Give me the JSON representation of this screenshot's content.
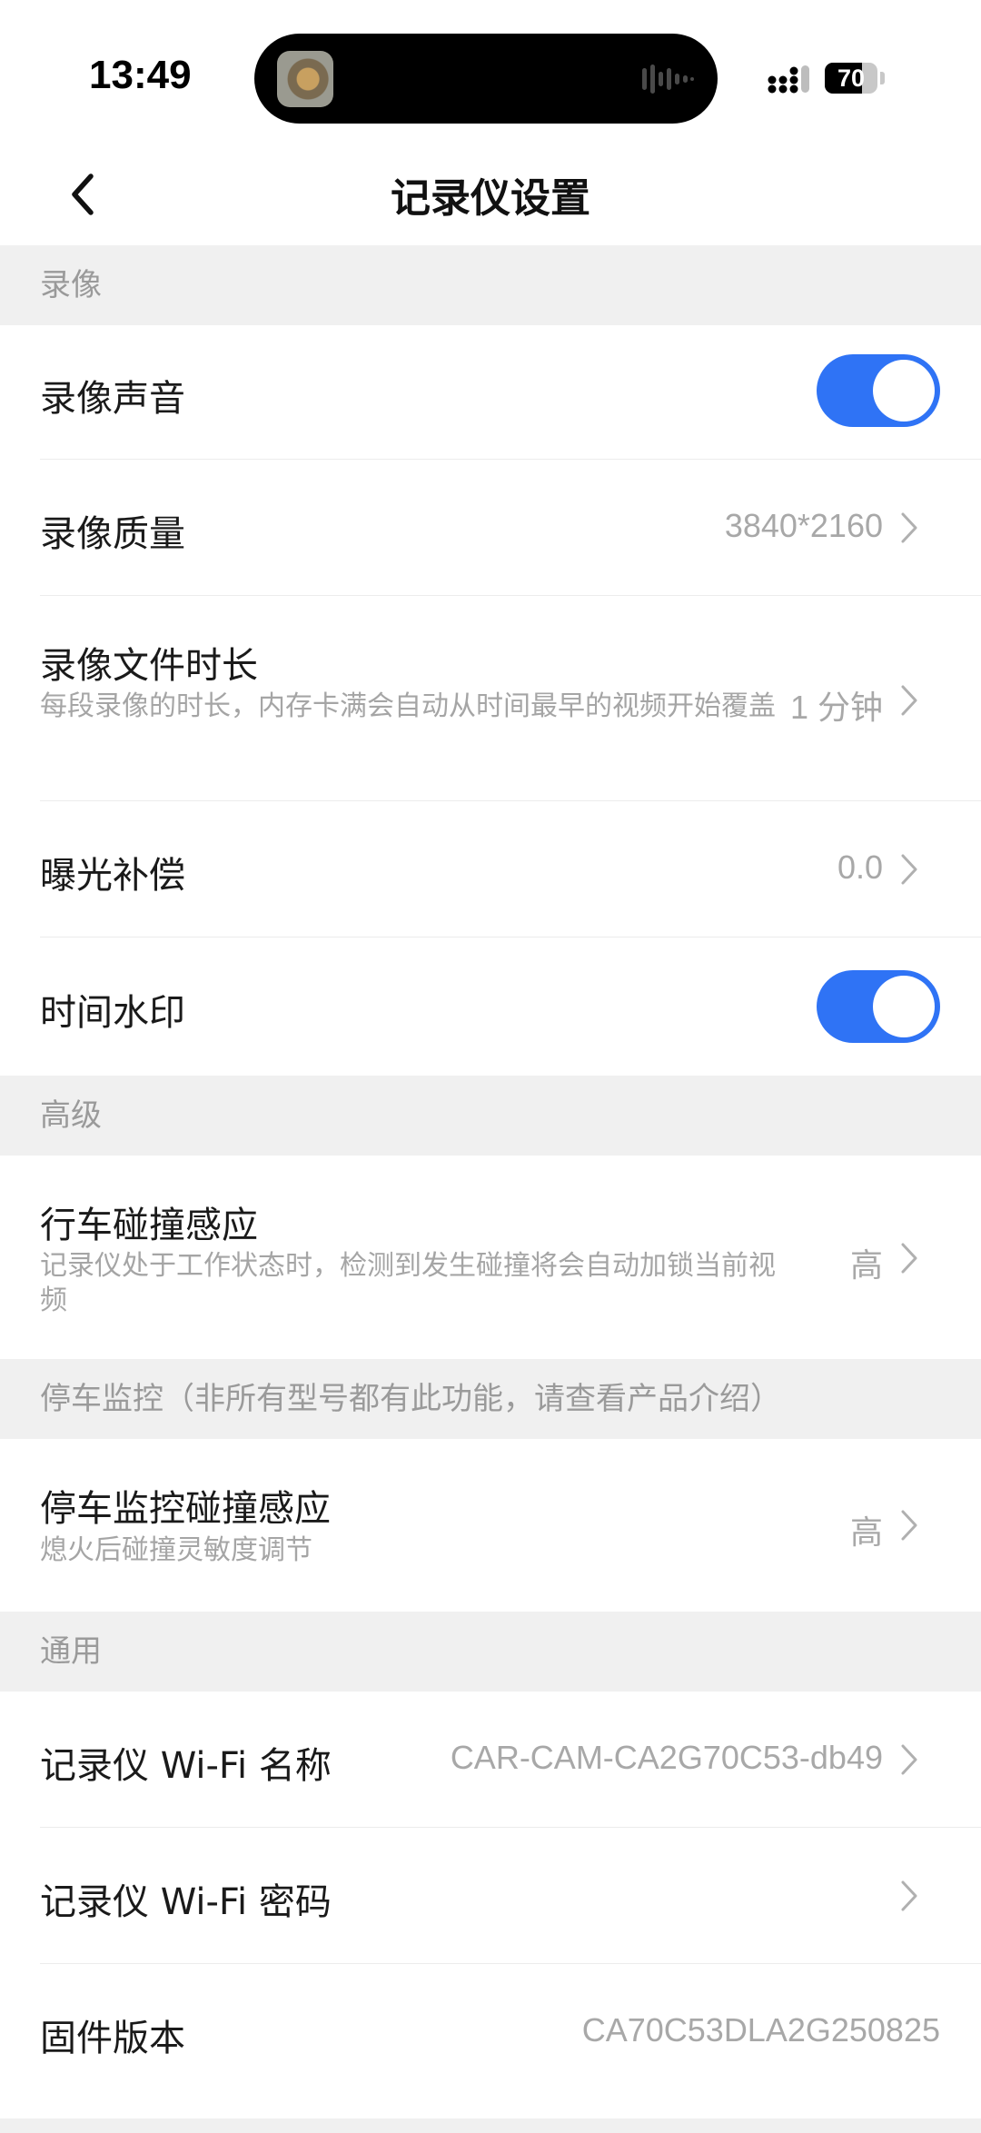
{
  "status_bar": {
    "time": "13:49",
    "battery_level": "70",
    "battery_fraction": 0.7
  },
  "nav": {
    "title": "记录仪设置",
    "back_icon": "chevron-left-icon"
  },
  "sections": {
    "recording": {
      "header": "录像",
      "rows": {
        "audio": {
          "title": "录像声音",
          "toggle_on": true
        },
        "quality": {
          "title": "录像质量",
          "value": "3840*2160"
        },
        "duration": {
          "title": "录像文件时长",
          "desc": "每段录像的时长，内存卡满会自动从时间最早的视频开始覆盖",
          "value": "1 分钟"
        },
        "exposure": {
          "title": "曝光补偿",
          "value": "0.0"
        },
        "watermark": {
          "title": "时间水印",
          "toggle_on": true
        }
      }
    },
    "advanced": {
      "header": "高级",
      "rows": {
        "collision": {
          "title": "行车碰撞感应",
          "desc": "记录仪处于工作状态时，检测到发生碰撞将会自动加锁当前视频",
          "value": "高"
        }
      }
    },
    "parking": {
      "header": "停车监控（非所有型号都有此功能，请查看产品介绍）",
      "rows": {
        "parking_collision": {
          "title": "停车监控碰撞感应",
          "desc": "熄火后碰撞灵敏度调节",
          "value": "高"
        }
      }
    },
    "general": {
      "header": "通用",
      "rows": {
        "wifi_name": {
          "title": "记录仪 Wi-Fi 名称",
          "value": "CAR-CAM-CA2G70C53-db49"
        },
        "wifi_password": {
          "title": "记录仪 Wi-Fi 密码"
        },
        "firmware": {
          "title": "固件版本",
          "value": "CA70C53DLA2G250825"
        }
      }
    }
  },
  "colors": {
    "accent": "#2f73f5",
    "section_bg": "#f0f0f0",
    "secondary_text": "#a8a8a8"
  }
}
